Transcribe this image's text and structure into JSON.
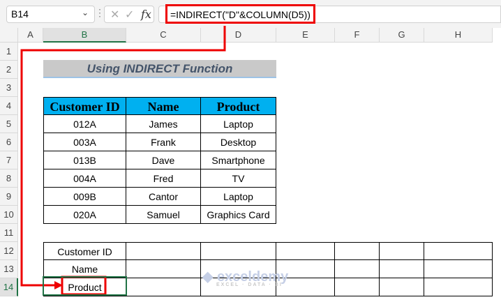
{
  "name_box": "B14",
  "formula": "=INDIRECT(\"D\"&COLUMN(D5))",
  "columns": [
    "A",
    "B",
    "C",
    "D",
    "E",
    "F",
    "G",
    "H"
  ],
  "rows": [
    "1",
    "2",
    "3",
    "4",
    "5",
    "6",
    "7",
    "8",
    "9",
    "10",
    "11",
    "12",
    "13",
    "14"
  ],
  "title": "Using INDIRECT Function",
  "table": {
    "headers": [
      "Customer ID",
      "Name",
      "Product"
    ],
    "rows": [
      [
        "012A",
        "James",
        "Laptop"
      ],
      [
        "003A",
        "Frank",
        "Desktop"
      ],
      [
        "013B",
        "Dave",
        "Smartphone"
      ],
      [
        "004A",
        "Fred",
        "TV"
      ],
      [
        "009B",
        "Cantor",
        "Laptop"
      ],
      [
        "020A",
        "Samuel",
        "Graphics Card"
      ]
    ]
  },
  "lookup": {
    "labels": [
      "Customer ID",
      "Name",
      "Product"
    ]
  },
  "watermark": {
    "brand": "exceldemy",
    "tagline": "EXCEL · DATA · BI"
  },
  "accent": "#ee0000"
}
